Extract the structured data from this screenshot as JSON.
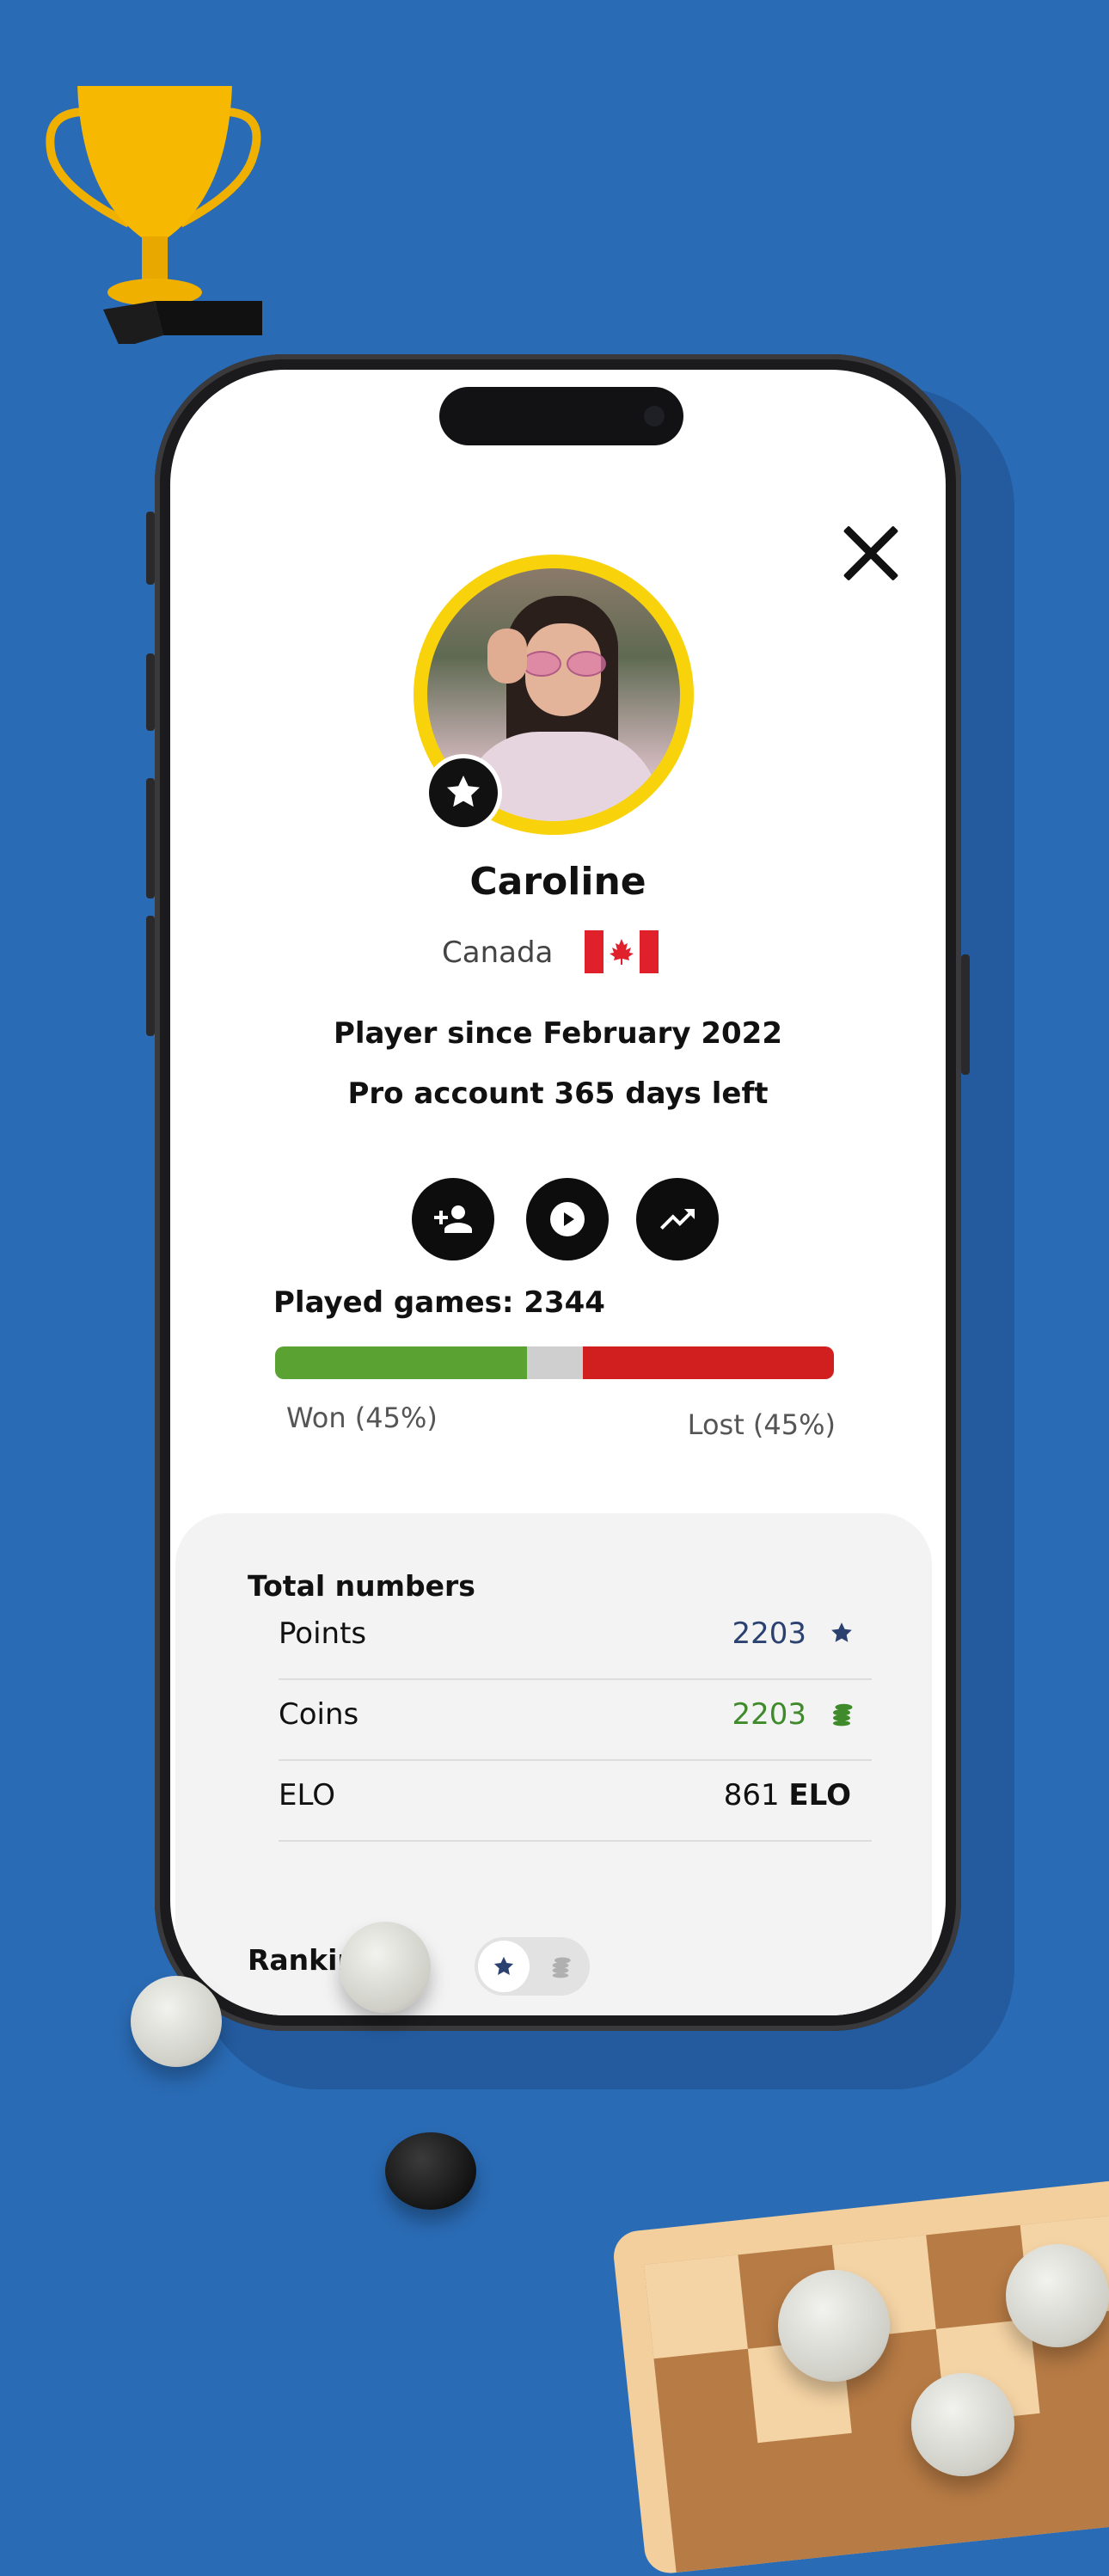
{
  "profile": {
    "name": "Caroline",
    "country": "Canada",
    "player_since": "Player since February 2022",
    "pro_account": "Pro account 365 days left"
  },
  "actions": [
    {
      "icon": "add-friend-icon"
    },
    {
      "icon": "play-icon"
    },
    {
      "icon": "trending-up-icon"
    }
  ],
  "games": {
    "played_label": "Played games: 2344",
    "won_label": "Won (45%)",
    "lost_label": "Lost (45%)",
    "won_fraction": 0.45,
    "draw_fraction": 0.1,
    "lost_fraction": 0.45
  },
  "totals": {
    "title": "Total numbers",
    "rows": [
      {
        "label": "Points",
        "value": "2203",
        "icon": "star-icon"
      },
      {
        "label": "Coins",
        "value": "2203",
        "icon": "coins-icon"
      },
      {
        "label": "ELO",
        "value": "861",
        "suffix": "ELO"
      }
    ]
  },
  "ranking": {
    "title": "Ranking",
    "toggle_selected": "points",
    "toggle_options": [
      "star-icon",
      "coins-icon"
    ]
  },
  "colors": {
    "background": "#2a6bb5",
    "avatar_ring": "#f8d20a",
    "won": "#5aa332",
    "draw": "#cfcfcf",
    "lost": "#d11e1e",
    "points_value": "#2b4170",
    "coins_value": "#3f8a2a"
  }
}
